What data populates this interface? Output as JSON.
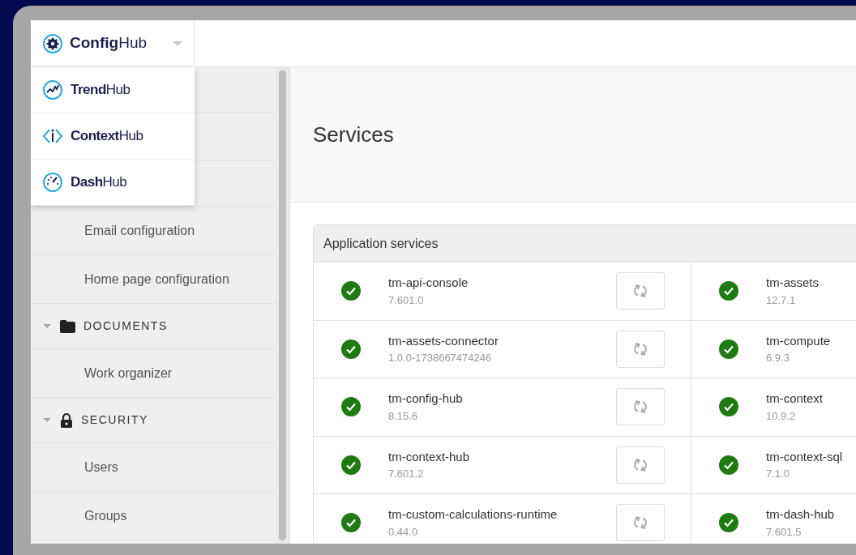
{
  "app_switcher": {
    "current": "**Config**Hub",
    "expanded": true,
    "options": [
      {
        "label": "**Trend**Hub",
        "kind": "trend"
      },
      {
        "label": "**Context**Hub",
        "kind": "context"
      },
      {
        "label": "**Dash**Hub",
        "kind": "dash"
      }
    ]
  },
  "sidebar": {
    "items": [
      {
        "kind": "link",
        "label": "Email configuration"
      },
      {
        "kind": "link",
        "label": "Home page configuration"
      },
      {
        "kind": "section",
        "label": "DOCUMENTS",
        "expanded": true
      },
      {
        "kind": "link",
        "label": "Work organizer"
      },
      {
        "kind": "section",
        "label": "SECURITY",
        "expanded": true
      },
      {
        "kind": "link",
        "label": "Users"
      },
      {
        "kind": "link",
        "label": "Groups"
      }
    ]
  },
  "page": {
    "title": "Services"
  },
  "panel": {
    "title": "Application services",
    "rows": [
      {
        "cells": [
          {
            "name": "tm-api-console",
            "version": "7.601.0",
            "healthy": true
          },
          {
            "name": "tm-assets",
            "version": "12.7.1",
            "healthy": true
          }
        ]
      },
      {
        "cells": [
          {
            "name": "tm-assets-connector",
            "version": "1.0.0-1738667474246",
            "healthy": true
          },
          {
            "name": "tm-compute",
            "version": "6.9.3",
            "healthy": true
          }
        ]
      },
      {
        "cells": [
          {
            "name": "tm-config-hub",
            "version": "8.15.6",
            "healthy": true
          },
          {
            "name": "tm-context",
            "version": "10.9.2",
            "healthy": true
          }
        ]
      },
      {
        "cells": [
          {
            "name": "tm-context-hub",
            "version": "7.601.2",
            "healthy": true
          },
          {
            "name": "tm-context-sql",
            "version": "7.1.0",
            "healthy": true
          }
        ]
      },
      {
        "cells": [
          {
            "name": "tm-custom-calculations-runtime",
            "version": "0.44.0",
            "healthy": true
          },
          {
            "name": "tm-dash-hub",
            "version": "7.601.5",
            "healthy": true
          }
        ]
      }
    ]
  }
}
